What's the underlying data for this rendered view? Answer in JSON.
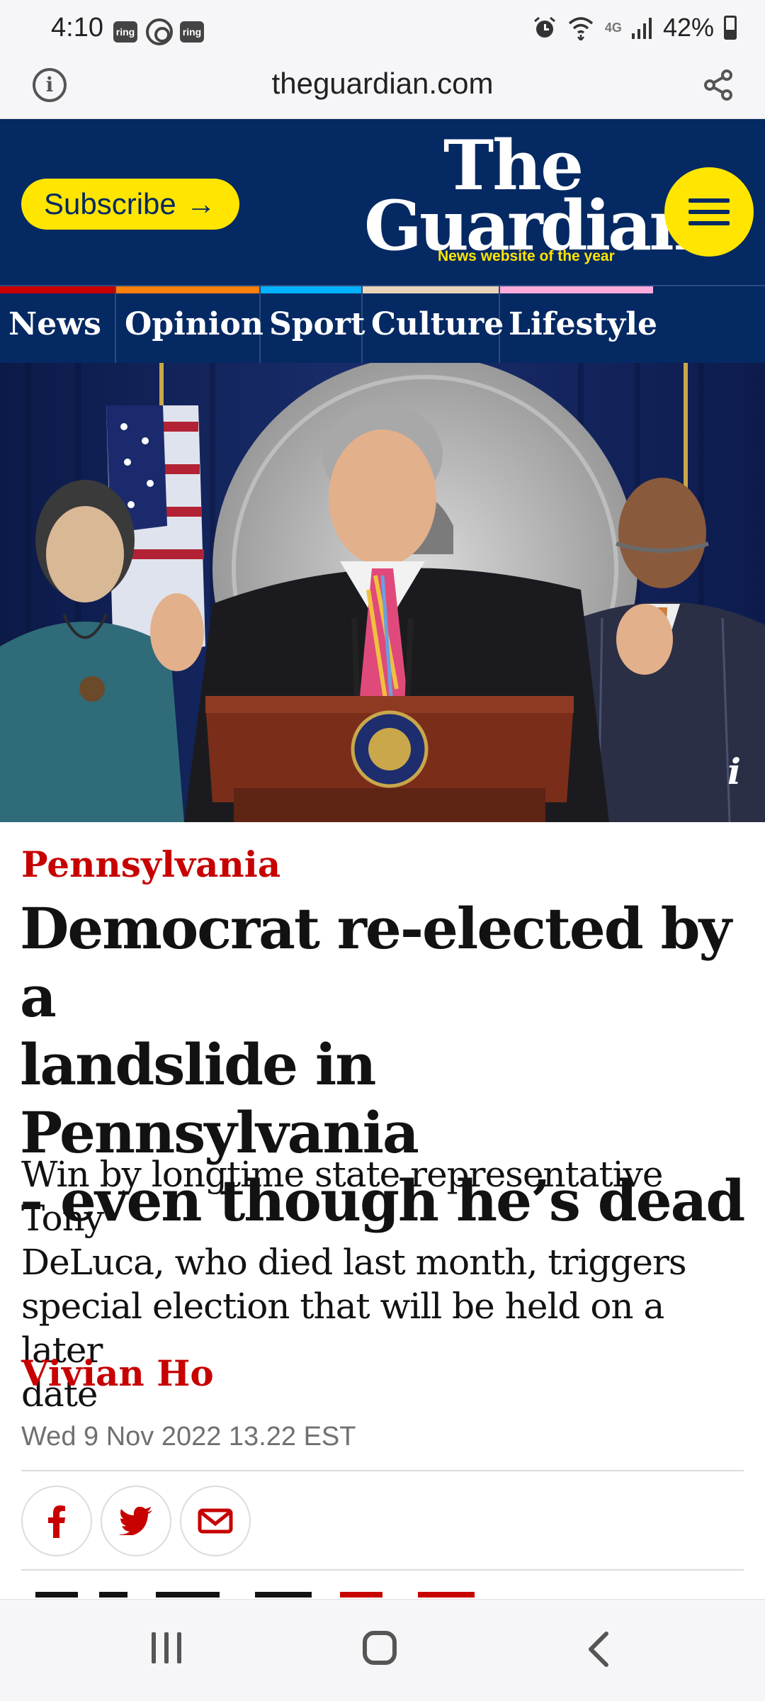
{
  "status_bar": {
    "time": "4:10",
    "ring1": "ring",
    "ring2": "ring",
    "network": "4G",
    "battery": "42%"
  },
  "browser": {
    "url": "theguardian.com"
  },
  "header": {
    "subscribe_label": "Subscribe",
    "logo_the": "The",
    "logo_guardian": "Guardian",
    "logo_tagline": "News website of the year",
    "colors": {
      "navy": "#052962",
      "yellow": "#ffe500",
      "red": "#c70000"
    }
  },
  "nav": {
    "items": [
      {
        "label": "News",
        "accent": "#c70000"
      },
      {
        "label": "Opinion",
        "accent": "#ff7f0f"
      },
      {
        "label": "Sport",
        "accent": "#00b2ff"
      },
      {
        "label": "Culture",
        "accent": "#e7d4b9"
      },
      {
        "label": "Lifestyle",
        "accent": "#ffabdb"
      }
    ]
  },
  "hero": {
    "info_badge": "i"
  },
  "article": {
    "kicker": "Pennsylvania",
    "headline_lines": [
      "Democrat re-elected by a",
      "landslide in Pennsylvania",
      "- even though he’s dead"
    ],
    "standfirst_lines": [
      "Win by longtime state representative Tony",
      "DeLuca, who died last month, triggers",
      "special election that will be held on a later",
      "date"
    ],
    "byline": "Vivian Ho",
    "date": "Wed 9 Nov 2022 13.22 EST",
    "share_buttons": [
      "facebook-icon",
      "twitter-icon",
      "email-icon"
    ]
  },
  "system_nav": {
    "buttons": [
      "recent-apps",
      "home",
      "back"
    ]
  }
}
